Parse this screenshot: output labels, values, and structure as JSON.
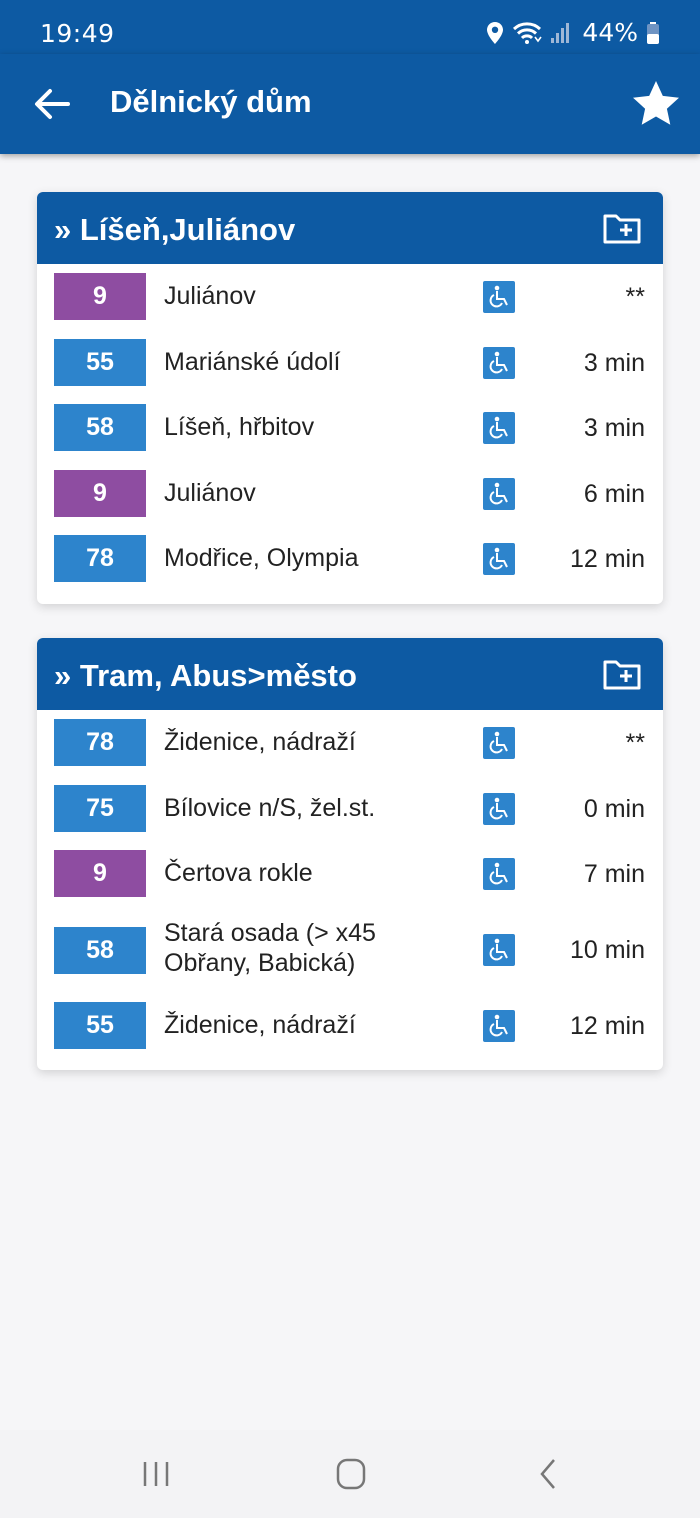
{
  "status": {
    "time": "19:49",
    "battery": "44%",
    "icons": [
      "location-icon",
      "wifi-icon",
      "signal-icon",
      "battery-icon"
    ]
  },
  "header": {
    "title": "Dělnický dům",
    "back_icon": "back-arrow-icon",
    "favorite_icon": "star-icon"
  },
  "colors": {
    "primary": "#0d5aa3",
    "bus_line": "#2d84cc",
    "tram_line": "#8e4da1",
    "accessible": "#2d84cc"
  },
  "sections": [
    {
      "title": "» Líšeň,Juliánov",
      "departures": [
        {
          "line": "9",
          "destination": "Juliánov",
          "time": "**",
          "type": "tram"
        },
        {
          "line": "55",
          "destination": "Mariánské údolí",
          "time": "3 min",
          "type": "bus"
        },
        {
          "line": "58",
          "destination": "Líšeň, hřbitov",
          "time": "3 min",
          "type": "bus"
        },
        {
          "line": "9",
          "destination": "Juliánov",
          "time": "6 min",
          "type": "tram"
        },
        {
          "line": "78",
          "destination": "Modřice, Olympia",
          "time": "12 min",
          "type": "bus"
        }
      ]
    },
    {
      "title": "» Tram, Abus>město",
      "departures": [
        {
          "line": "78",
          "destination": "Židenice, nádraží",
          "time": "**",
          "type": "bus"
        },
        {
          "line": "75",
          "destination": "Bílovice n/S, žel.st.",
          "time": "0 min",
          "type": "bus"
        },
        {
          "line": "9",
          "destination": "Čertova rokle",
          "time": "7 min",
          "type": "tram"
        },
        {
          "line": "58",
          "destination": "Stará osada (> x45 Obřany, Babická)",
          "time": "10 min",
          "type": "bus"
        },
        {
          "line": "55",
          "destination": "Židenice, nádraží",
          "time": "12 min",
          "type": "bus"
        }
      ]
    }
  ]
}
